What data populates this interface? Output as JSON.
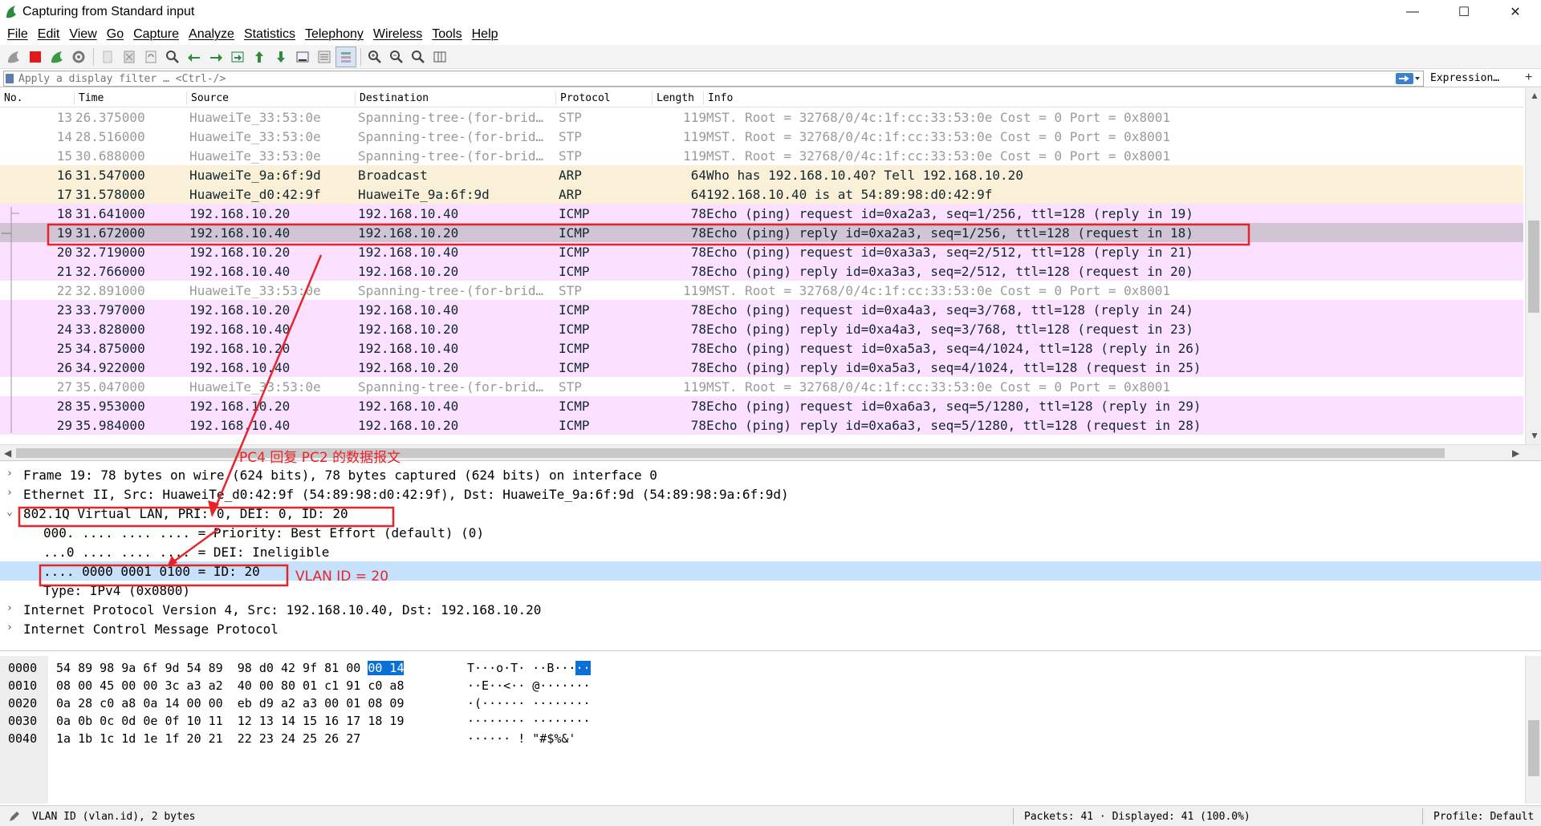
{
  "window": {
    "title": "Capturing from Standard input",
    "min": "—",
    "max": "☐",
    "close": "✕"
  },
  "menu": [
    "File",
    "Edit",
    "View",
    "Go",
    "Capture",
    "Analyze",
    "Statistics",
    "Telephony",
    "Wireless",
    "Tools",
    "Help"
  ],
  "filter": {
    "placeholder": "Apply a display filter … <Ctrl-/>",
    "expression_label": "Expression…",
    "plus": "+"
  },
  "columns": [
    "No.",
    "Time",
    "Source",
    "Destination",
    "Protocol",
    "Length",
    "Info"
  ],
  "packets": [
    {
      "no": "13",
      "time": "26.375000",
      "src": "HuaweiTe_33:53:0e",
      "dst": "Spanning-tree-(for-brid…",
      "proto": "STP",
      "len": "119",
      "info": "MST. Root = 32768/0/4c:1f:cc:33:53:0e  Cost = 0  Port = 0x8001",
      "cls": "stp"
    },
    {
      "no": "14",
      "time": "28.516000",
      "src": "HuaweiTe_33:53:0e",
      "dst": "Spanning-tree-(for-brid…",
      "proto": "STP",
      "len": "119",
      "info": "MST. Root = 32768/0/4c:1f:cc:33:53:0e  Cost = 0  Port = 0x8001",
      "cls": "stp"
    },
    {
      "no": "15",
      "time": "30.688000",
      "src": "HuaweiTe_33:53:0e",
      "dst": "Spanning-tree-(for-brid…",
      "proto": "STP",
      "len": "119",
      "info": "MST. Root = 32768/0/4c:1f:cc:33:53:0e  Cost = 0  Port = 0x8001",
      "cls": "stp"
    },
    {
      "no": "16",
      "time": "31.547000",
      "src": "HuaweiTe_9a:6f:9d",
      "dst": "Broadcast",
      "proto": "ARP",
      "len": "64",
      "info": "Who has 192.168.10.40? Tell 192.168.10.20",
      "cls": "arp"
    },
    {
      "no": "17",
      "time": "31.578000",
      "src": "HuaweiTe_d0:42:9f",
      "dst": "HuaweiTe_9a:6f:9d",
      "proto": "ARP",
      "len": "64",
      "info": "192.168.10.40 is at 54:89:98:d0:42:9f",
      "cls": "arp"
    },
    {
      "no": "18",
      "time": "31.641000",
      "src": "192.168.10.20",
      "dst": "192.168.10.40",
      "proto": "ICMP",
      "len": "78",
      "info": "Echo (ping) request  id=0xa2a3, seq=1/256, ttl=128 (reply in 19)",
      "cls": "icmp"
    },
    {
      "no": "19",
      "time": "31.672000",
      "src": "192.168.10.40",
      "dst": "192.168.10.20",
      "proto": "ICMP",
      "len": "78",
      "info": "Echo (ping) reply    id=0xa2a3, seq=1/256, ttl=128 (request in 18)",
      "cls": "icmp selected"
    },
    {
      "no": "20",
      "time": "32.719000",
      "src": "192.168.10.20",
      "dst": "192.168.10.40",
      "proto": "ICMP",
      "len": "78",
      "info": "Echo (ping) request  id=0xa3a3, seq=2/512, ttl=128 (reply in 21)",
      "cls": "icmp"
    },
    {
      "no": "21",
      "time": "32.766000",
      "src": "192.168.10.40",
      "dst": "192.168.10.20",
      "proto": "ICMP",
      "len": "78",
      "info": "Echo (ping) reply    id=0xa3a3, seq=2/512, ttl=128 (request in 20)",
      "cls": "icmp"
    },
    {
      "no": "22",
      "time": "32.891000",
      "src": "HuaweiTe_33:53:0e",
      "dst": "Spanning-tree-(for-brid…",
      "proto": "STP",
      "len": "119",
      "info": "MST. Root = 32768/0/4c:1f:cc:33:53:0e  Cost = 0  Port = 0x8001",
      "cls": "stp"
    },
    {
      "no": "23",
      "time": "33.797000",
      "src": "192.168.10.20",
      "dst": "192.168.10.40",
      "proto": "ICMP",
      "len": "78",
      "info": "Echo (ping) request  id=0xa4a3, seq=3/768, ttl=128 (reply in 24)",
      "cls": "icmp"
    },
    {
      "no": "24",
      "time": "33.828000",
      "src": "192.168.10.40",
      "dst": "192.168.10.20",
      "proto": "ICMP",
      "len": "78",
      "info": "Echo (ping) reply    id=0xa4a3, seq=3/768, ttl=128 (request in 23)",
      "cls": "icmp"
    },
    {
      "no": "25",
      "time": "34.875000",
      "src": "192.168.10.20",
      "dst": "192.168.10.40",
      "proto": "ICMP",
      "len": "78",
      "info": "Echo (ping) request  id=0xa5a3, seq=4/1024, ttl=128 (reply in 26)",
      "cls": "icmp"
    },
    {
      "no": "26",
      "time": "34.922000",
      "src": "192.168.10.40",
      "dst": "192.168.10.20",
      "proto": "ICMP",
      "len": "78",
      "info": "Echo (ping) reply    id=0xa5a3, seq=4/1024, ttl=128 (request in 25)",
      "cls": "icmp"
    },
    {
      "no": "27",
      "time": "35.047000",
      "src": "HuaweiTe_33:53:0e",
      "dst": "Spanning-tree-(for-brid…",
      "proto": "STP",
      "len": "119",
      "info": "MST. Root = 32768/0/4c:1f:cc:33:53:0e  Cost = 0  Port = 0x8001",
      "cls": "stp"
    },
    {
      "no": "28",
      "time": "35.953000",
      "src": "192.168.10.20",
      "dst": "192.168.10.40",
      "proto": "ICMP",
      "len": "78",
      "info": "Echo (ping) request  id=0xa6a3, seq=5/1280, ttl=128 (reply in 29)",
      "cls": "icmp"
    },
    {
      "no": "29",
      "time": "35.984000",
      "src": "192.168.10.40",
      "dst": "192.168.10.20",
      "proto": "ICMP",
      "len": "78",
      "info": "Echo (ping) reply    id=0xa6a3, seq=5/1280, ttl=128 (request in 28)",
      "cls": "icmp"
    }
  ],
  "annotations": {
    "reply_note": "PC4 回复 PC2 的数据报文",
    "vlan_note": "VLAN ID = 20",
    "color": "#e8242a"
  },
  "details": [
    {
      "exp": ">",
      "text": "Frame 19: 78 bytes on wire (624 bits), 78 bytes captured (624 bits) on interface 0",
      "indent": 0
    },
    {
      "exp": ">",
      "text": "Ethernet II, Src: HuaweiTe_d0:42:9f (54:89:98:d0:42:9f), Dst: HuaweiTe_9a:6f:9d (54:89:98:9a:6f:9d)",
      "indent": 0
    },
    {
      "exp": "v",
      "text": "802.1Q Virtual LAN, PRI: 0, DEI: 0, ID: 20",
      "indent": 0
    },
    {
      "exp": "",
      "text": "000. .... .... .... = Priority: Best Effort (default) (0)",
      "indent": 1
    },
    {
      "exp": "",
      "text": "...0 .... .... .... = DEI: Ineligible",
      "indent": 1
    },
    {
      "exp": "",
      "text": ".... 0000 0001 0100 = ID: 20",
      "indent": 1,
      "selected": true
    },
    {
      "exp": "",
      "text": "Type: IPv4 (0x0800)",
      "indent": 1
    },
    {
      "exp": ">",
      "text": "Internet Protocol Version 4, Src: 192.168.10.40, Dst: 192.168.10.20",
      "indent": 0
    },
    {
      "exp": ">",
      "text": "Internet Control Message Protocol",
      "indent": 0
    }
  ],
  "bytes": [
    {
      "off": "0000",
      "hex_a": "54 89 98 9a 6f 9d 54 89  98 d0 42 9f 81 00 ",
      "hex_hl": "00 14",
      "asc_a": "T···o·T· ··B···",
      "asc_hl": "··"
    },
    {
      "off": "0010",
      "hex_a": "08 00 45 00 00 3c a3 a2  40 00 80 01 c1 91 c0 a8",
      "hex_hl": "",
      "asc_a": "··E··<·· @·······",
      "asc_hl": ""
    },
    {
      "off": "0020",
      "hex_a": "0a 28 c0 a8 0a 14 00 00  eb d9 a2 a3 00 01 08 09",
      "hex_hl": "",
      "asc_a": "·(······ ········",
      "asc_hl": ""
    },
    {
      "off": "0030",
      "hex_a": "0a 0b 0c 0d 0e 0f 10 11  12 13 14 15 16 17 18 19",
      "hex_hl": "",
      "asc_a": "········ ········",
      "asc_hl": ""
    },
    {
      "off": "0040",
      "hex_a": "1a 1b 1c 1d 1e 1f 20 21  22 23 24 25 26 27",
      "hex_hl": "",
      "asc_a": "······ ! \"#$%&'",
      "asc_hl": ""
    }
  ],
  "status": {
    "field": "VLAN ID (vlan.id), 2 bytes",
    "packets": "Packets: 41 · Displayed: 41 (100.0%)",
    "profile": "Profile: Default"
  }
}
